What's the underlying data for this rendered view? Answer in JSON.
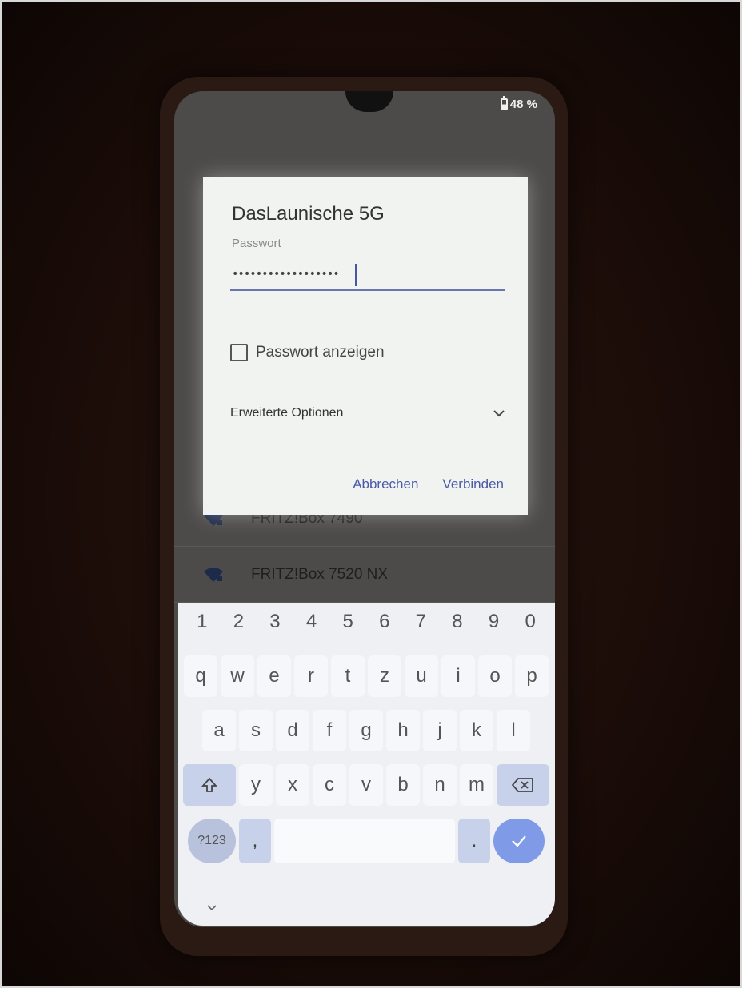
{
  "statusbar": {
    "battery": "48 %"
  },
  "wifi_list": [
    {
      "ssid": "FRITZ!Box 7490"
    },
    {
      "ssid": "FRITZ!Box 7520 NX"
    }
  ],
  "dialog": {
    "title": "DasLaunische 5G",
    "password_label": "Passwort",
    "password_value": "••••••••••••••••••",
    "show_password_label": "Passwort anzeigen",
    "show_password_checked": false,
    "advanced_options_label": "Erweiterte Optionen",
    "cancel_label": "Abbrechen",
    "connect_label": "Verbinden"
  },
  "keyboard": {
    "numbers": [
      "1",
      "2",
      "3",
      "4",
      "5",
      "6",
      "7",
      "8",
      "9",
      "0"
    ],
    "row1": [
      "q",
      "w",
      "e",
      "r",
      "t",
      "z",
      "u",
      "i",
      "o",
      "p"
    ],
    "row2": [
      "a",
      "s",
      "d",
      "f",
      "g",
      "h",
      "j",
      "k",
      "l"
    ],
    "row3": [
      "y",
      "x",
      "c",
      "v",
      "b",
      "n",
      "m"
    ],
    "symbols_label": "?123",
    "comma_label": ",",
    "period_label": "."
  },
  "colors": {
    "accent": "#4a5aa8",
    "enter_key": "#7f9be8"
  }
}
